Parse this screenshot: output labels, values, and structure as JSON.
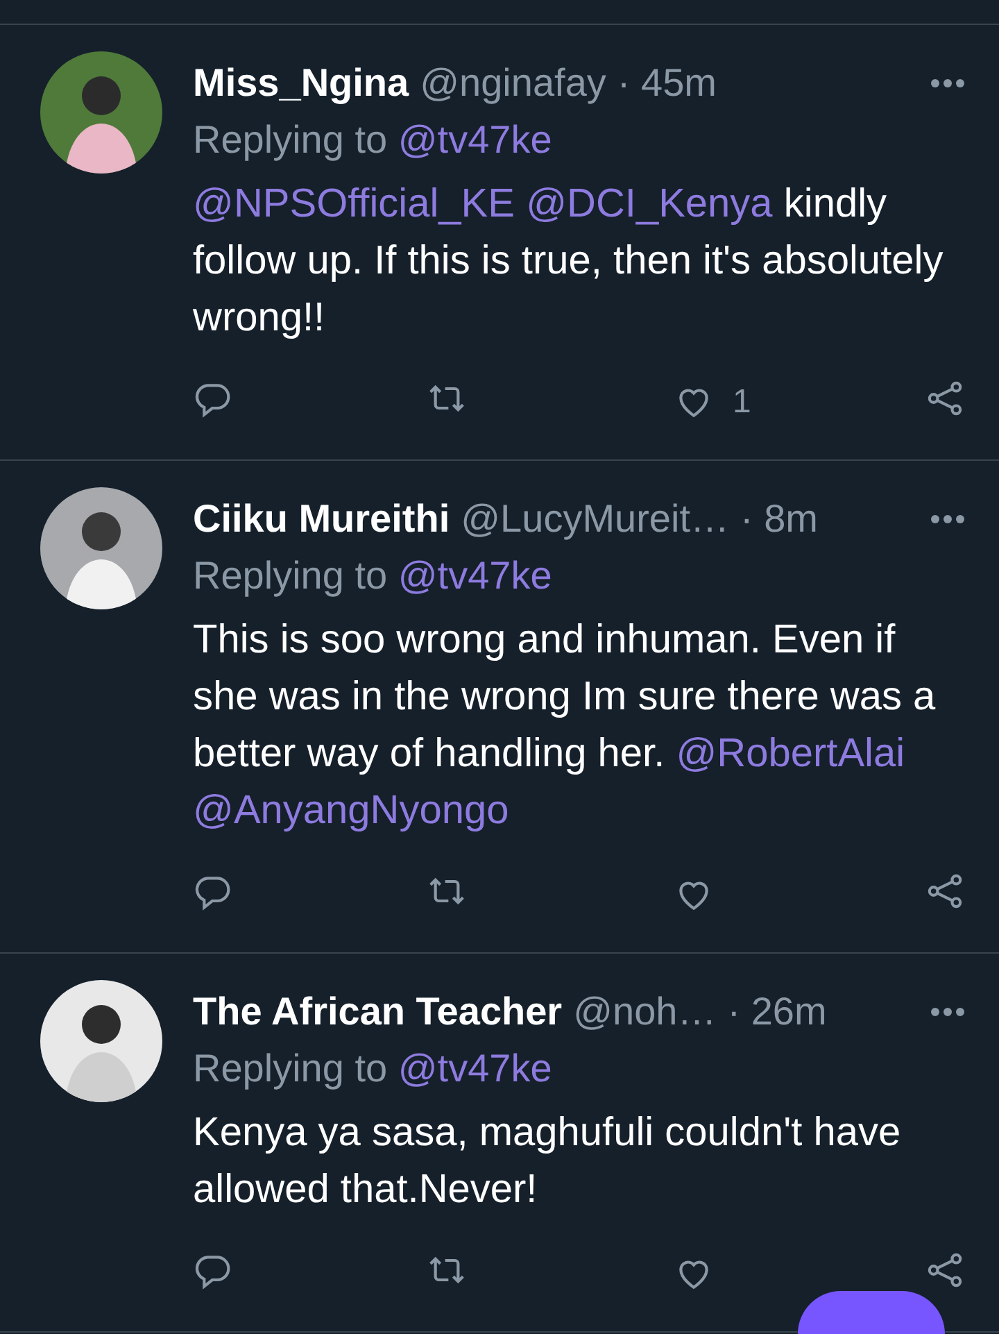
{
  "tweets": [
    {
      "name": "Miss_Ngina",
      "handle": "@nginafay",
      "time": "· 45m",
      "replying_label": "Replying to",
      "replying_to": "@tv47ke",
      "text": [
        {
          "kind": "mention",
          "text": "@NPSOfficial_KE"
        },
        {
          "kind": "mention",
          "text": "@DCI_Kenya"
        },
        {
          "kind": "plain",
          "text": "kindly follow up. If this is true, then it's absolutely wrong!!"
        }
      ],
      "like_count": "1"
    },
    {
      "name": "Ciiku Mureithi",
      "handle": "@LucyMureit…",
      "time": "· 8m",
      "replying_label": "Replying to",
      "replying_to": "@tv47ke",
      "text": [
        {
          "kind": "plain",
          "text": "This is soo wrong and inhuman. Even if she was in the wrong Im sure there was a better way of handling her."
        },
        {
          "kind": "mention",
          "text": "@RobertAlai"
        },
        {
          "kind": "mention",
          "text": "@AnyangNyongo"
        }
      ]
    },
    {
      "name": "The African Teacher",
      "handle": "@noh…",
      "time": "· 26m",
      "replying_label": "Replying to",
      "replying_to": "@tv47ke",
      "text": [
        {
          "kind": "plain",
          "text": "Kenya ya sasa, maghufuli couldn't have allowed that.Never!"
        }
      ]
    }
  ]
}
